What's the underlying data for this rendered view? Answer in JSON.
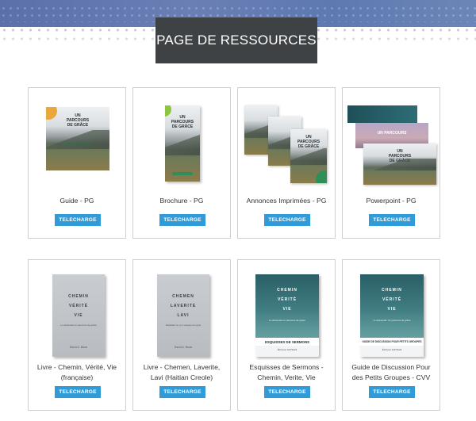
{
  "header": {
    "title": "PAGE DE RESSOURCES"
  },
  "resources": [
    {
      "label": "Guide - PG",
      "button": "TELECHARGE"
    },
    {
      "label": "Brochure - PG",
      "button": "TELECHARGE"
    },
    {
      "label": "Annonces Imprimées - PG",
      "button": "TELECHARGE"
    },
    {
      "label": "Powerpoint - PG",
      "button": "TELECHARGE"
    },
    {
      "label": "Livre - Chemin, Vérité, Vie (française)",
      "button": "TELECHARGE",
      "cover": {
        "title_lines": [
          "CHEMIN",
          "VÉRITÉ",
          "VIE"
        ],
        "subtitle": "Le discipulat un parcours de grâce",
        "author": "David A. Busic"
      }
    },
    {
      "label": "Livre - Chemen, Laverite, Lavi (Haitian Creole)",
      "button": "TELECHARGE",
      "cover": {
        "title_lines": [
          "CHEMEN",
          "LAVERITE",
          "LAVI"
        ],
        "subtitle": "Disipilant se yon vwayaj nan gras",
        "author": "David A. Busic"
      }
    },
    {
      "label": "Esquisses de Sermons - Chemin, Verite, Vie",
      "button": "TELECHARGE",
      "cover": {
        "title_lines": [
          "CHEMIN",
          "VÉRITÉ",
          "VIE"
        ],
        "subtitle": "Le discipulat un parcours de grâce",
        "band": "ESQUISSES DE SERMONS",
        "band_sub": "Écrit par Jeff Stark"
      }
    },
    {
      "label": "Guide de Discussion Pour des Petits Groupes - CVV",
      "button": "TELECHARGE",
      "cover": {
        "title_lines": [
          "CHEMIN",
          "VÉRITÉ",
          "VIE"
        ],
        "subtitle": "Le discipulat: Un parcours de grâce",
        "band": "GUIDE DE DISCUSSION POUR PETITS GROUPES",
        "band_sub": "Écrit par Jeff Stark"
      }
    }
  ],
  "covers": {
    "brand_lines": [
      "UN",
      "PARCOURS",
      "DE GRÂCE"
    ]
  },
  "colors": {
    "button": "#2f9bd9",
    "title_box": "#3f4244",
    "band_start": "#5b6fa8",
    "band_end": "#6d86b9"
  }
}
